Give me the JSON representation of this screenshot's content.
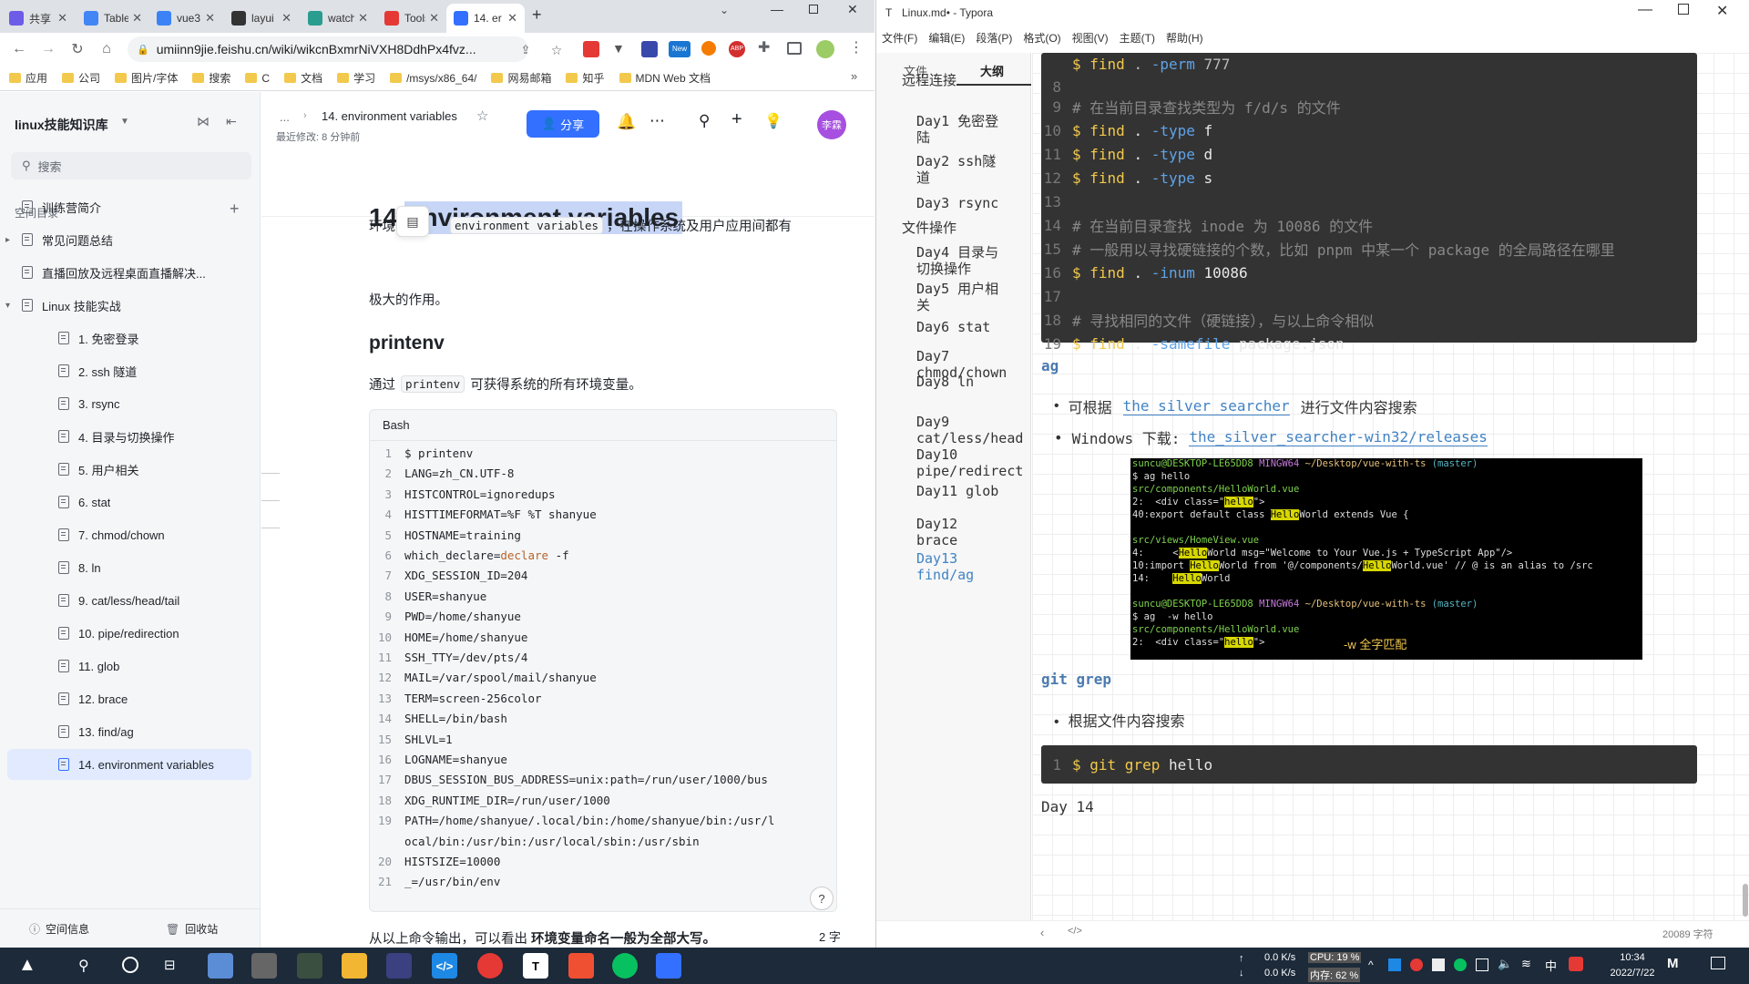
{
  "chrome": {
    "tabs": [
      {
        "label": "共享",
        "color": "#6c5ce7"
      },
      {
        "label": "Table",
        "color": "#4285f4"
      },
      {
        "label": "vue3",
        "color": "#3b82f6"
      },
      {
        "label": "layui",
        "color": "#333"
      },
      {
        "label": "watch",
        "color": "#2a9d8f"
      },
      {
        "label": "Tools",
        "color": "#e53935"
      },
      {
        "label": "14. er",
        "color": "#3370ff"
      }
    ],
    "new_tab": "+",
    "url": "umiinn9jie.feishu.cn/wiki/wikcnBxmrNiVXH8DdhPx4fvz...",
    "bookmarks": [
      "应用",
      "公司",
      "图片/字体",
      "搜索",
      "C",
      "文档",
      "学习",
      "/msys/x86_64/",
      "网易邮箱",
      "知乎",
      "MDN Web 文档"
    ],
    "more": "»"
  },
  "sidebar": {
    "space": "linux技能知识库",
    "search": "搜索",
    "toc_title": "空间目录",
    "items": [
      {
        "label": "训练营简介",
        "indent": 0,
        "arrow": ""
      },
      {
        "label": "常见问题总结",
        "indent": 0,
        "arrow": "▸"
      },
      {
        "label": "直播回放及远程桌面直播解决...",
        "indent": 0,
        "arrow": ""
      },
      {
        "label": "Linux 技能实战",
        "indent": 0,
        "arrow": "▾"
      },
      {
        "label": "1. 免密登录",
        "indent": 1,
        "arrow": ""
      },
      {
        "label": "2. ssh 隧道",
        "indent": 1,
        "arrow": ""
      },
      {
        "label": "3. rsync",
        "indent": 1,
        "arrow": ""
      },
      {
        "label": "4. 目录与切换操作",
        "indent": 1,
        "arrow": ""
      },
      {
        "label": "5. 用户相关",
        "indent": 1,
        "arrow": ""
      },
      {
        "label": "6. stat",
        "indent": 1,
        "arrow": ""
      },
      {
        "label": "7. chmod/chown",
        "indent": 1,
        "arrow": ""
      },
      {
        "label": "8. ln",
        "indent": 1,
        "arrow": ""
      },
      {
        "label": "9. cat/less/head/tail",
        "indent": 1,
        "arrow": ""
      },
      {
        "label": "10. pipe/redirection",
        "indent": 1,
        "arrow": ""
      },
      {
        "label": "11. glob",
        "indent": 1,
        "arrow": ""
      },
      {
        "label": "12. brace",
        "indent": 1,
        "arrow": ""
      },
      {
        "label": "13. find/ag",
        "indent": 1,
        "arrow": ""
      },
      {
        "label": "14. environment variables",
        "indent": 1,
        "arrow": "",
        "selected": true
      }
    ],
    "footer_info": "空间信息",
    "footer_trash": "回收站"
  },
  "doc": {
    "breadcrumb_more": "...",
    "breadcrumb_title": "14. environment variables",
    "modified": "最近修改: 8 分钟前",
    "share": "分享",
    "avatar": "李霖",
    "h1_num": "14. ",
    "h1_text": "environment variables",
    "intro_pre": "环境",
    "intro_code": "environment variables",
    "intro_post": "，在操作系统及用户应用间都有",
    "intro_line2": "极大的作用。",
    "h2": "printenv",
    "p2_pre": "通过",
    "p2_code": "printenv",
    "p2_post": "可获得系统的所有环境变量。",
    "code_lang": "Bash",
    "code_lines": [
      "$ printenv",
      "LANG=zh_CN.UTF-8",
      "HISTCONTROL=ignoredups",
      "HISTTIMEFORMAT=%F %T shanyue",
      "HOSTNAME=training",
      "which_declare=declare -f",
      "XDG_SESSION_ID=204",
      "USER=shanyue",
      "PWD=/home/shanyue",
      "HOME=/home/shanyue",
      "SSH_TTY=/dev/pts/4",
      "MAIL=/var/spool/mail/shanyue",
      "TERM=screen-256color",
      "SHELL=/bin/bash",
      "SHLVL=1",
      "LOGNAME=shanyue",
      "DBUS_SESSION_BUS_ADDRESS=unix:path=/run/user/1000/bus",
      "XDG_RUNTIME_DIR=/run/user/1000",
      "PATH=/home/shanyue/.local/bin:/home/shanyue/bin:/usr/l",
      "HISTSIZE=10000",
      "_=/usr/bin/env"
    ],
    "code_line19_wrap": "ocal/bin:/usr/bin:/usr/local/sbin:/usr/sbin",
    "bottom_pre": "从以上命令输出，可以看出",
    "bottom_bold": "环境变量命名一般为全部大写。",
    "wordcount": "2 字",
    "help": "?"
  },
  "typora": {
    "title": "Linux.md• - Typora",
    "menu": [
      "文件(F)",
      "编辑(E)",
      "段落(P)",
      "格式(O)",
      "视图(V)",
      "主题(T)",
      "帮助(H)"
    ],
    "tab_files": "文件",
    "tab_outline": "大纲",
    "outline": [
      {
        "label": "远程连接",
        "level": 1
      },
      {
        "label": "Day1 免密登\n陆",
        "level": 2
      },
      {
        "label": "Day2 ssh隧\n道",
        "level": 2
      },
      {
        "label": "Day3 rsync",
        "level": 2
      },
      {
        "label": "文件操作",
        "level": 1
      },
      {
        "label": "Day4 目录与\n切换操作",
        "level": 2
      },
      {
        "label": "Day5 用户相\n关",
        "level": 2
      },
      {
        "label": "Day6 stat",
        "level": 2
      },
      {
        "label": "Day7\nchmod/chown",
        "level": 2
      },
      {
        "label": "Day8 ln",
        "level": 2
      },
      {
        "label": "Day9\ncat/less/head",
        "level": 2
      },
      {
        "label": "Day10\npipe/redirect",
        "level": 2
      },
      {
        "label": "Day11 glob",
        "level": 2
      },
      {
        "label": "Day12\nbrace",
        "level": 2
      },
      {
        "label": "Day13\nfind/ag",
        "level": 2,
        "active": true
      }
    ],
    "code1": [
      {
        "n": "",
        "t": "$ find . -perm 777",
        "k": "cmd"
      },
      {
        "n": "9",
        "t": "",
        "k": "blank"
      },
      {
        "n": "10",
        "t": "$ find . -type f",
        "k": "cmd"
      },
      {
        "n": "11",
        "t": "$ find . -type d",
        "k": "cmd"
      },
      {
        "n": "12",
        "t": "$ find . -type s",
        "k": "cmd"
      },
      {
        "n": "13",
        "t": "",
        "k": "blank"
      },
      {
        "n": "14",
        "t": "# 在当前目录查找 inode 为 10086 的文件",
        "k": "comment"
      },
      {
        "n": "15",
        "t": "# 一般用以寻找硬链接的个数，比如 pnpm 中某一个 package 的全局路径在哪里",
        "k": "comment"
      },
      {
        "n": "16",
        "t": "$ find . -inum 10086",
        "k": "cmd"
      },
      {
        "n": "17",
        "t": "",
        "k": "blank"
      },
      {
        "n": "18",
        "t": "# 寻找相同的文件（硬链接），与以上命令相似",
        "k": "comment"
      },
      {
        "n": "19",
        "t": "$ find . -samefile package.json",
        "k": "cmd"
      }
    ],
    "code1_comment9": "# 在当前目录查找类型为 f/d/s 的文件",
    "ag_heading": "ag",
    "ag_b1_pre": "可根据",
    "ag_b1_link": "the silver searcher",
    "ag_b1_post": "进行文件内容搜索",
    "ag_b2_pre": "Windows 下载:",
    "ag_b2_link": "the_silver_searcher-win32/releases",
    "terminal": {
      "prompt1_user": "suncu@DESKTOP-LE65DD8",
      "prompt1_env": "MINGW64",
      "prompt1_path": "~/Desktop/vue-with-ts",
      "prompt1_branch": "(master)",
      "cmd1": "$ ag hello",
      "file1": "src/components/HelloWorld.vue",
      "r1": "2:  <div class=\"hello\">",
      "r2": "40:export default class HelloWorld extends Vue {",
      "file2": "src/views/HomeView.vue",
      "r3": "4:     <HelloWorld msg=\"Welcome to Your Vue.js + TypeScript App\"/>",
      "r4": "10:import HelloWorld from '@/components/HelloWorld.vue' // @ is an alias to /src",
      "r5": "14:    HelloWorld",
      "cmd2": "$ ag  -w hello",
      "file3": "src/components/HelloWorld.vue",
      "r6": "2:  <div class=\"hello\">",
      "note": "-w 全字匹配"
    },
    "gitgrep_heading": "git grep",
    "gitgrep_bullet": "根据文件内容搜索",
    "code2_n": "1",
    "code2": "$ git grep hello",
    "day14": "Day 14",
    "wordcount": "20089 字符"
  },
  "taskbar": {
    "net_up": "0.0 K/s",
    "net_down": "0.0 K/s",
    "cpu": "CPU: 19 %",
    "mem": "内存: 62 %",
    "time": "10:34",
    "date": "2022/7/22"
  }
}
